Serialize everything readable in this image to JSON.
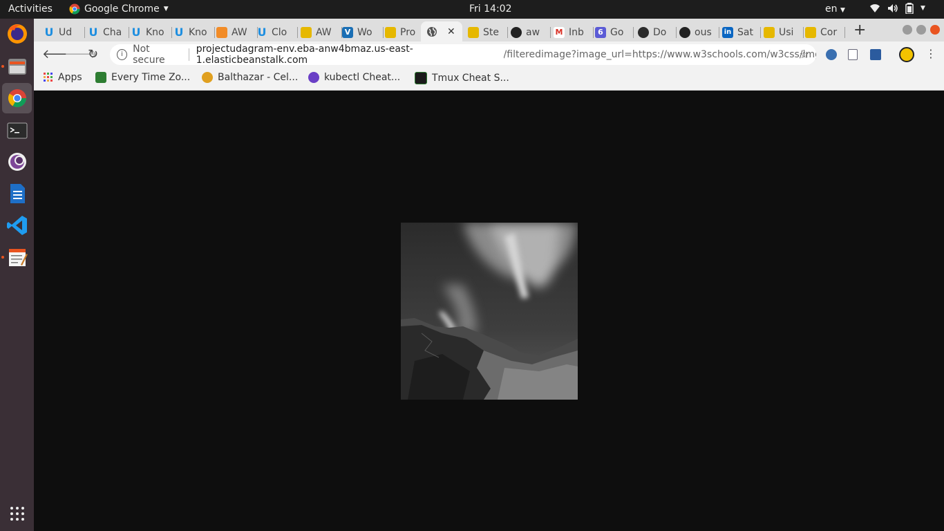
{
  "topbar": {
    "activities": "Activities",
    "app_name": "Google Chrome",
    "clock": "Fri 14:02",
    "language": "en"
  },
  "dock": {
    "items": [
      "firefox",
      "files",
      "chrome",
      "terminal",
      "tor-browser",
      "libreoffice-writer",
      "vscode",
      "text-editor"
    ],
    "show_apps_icon": "grid-icon"
  },
  "tabs": [
    {
      "label": "Ud",
      "icon": "udacity-icon",
      "color": "#1f8fe0"
    },
    {
      "label": "Cha",
      "icon": "udacity-icon",
      "color": "#1f8fe0"
    },
    {
      "label": "Kno",
      "icon": "udacity-icon",
      "color": "#1f8fe0"
    },
    {
      "label": "Kno",
      "icon": "udacity-icon",
      "color": "#1f8fe0"
    },
    {
      "label": "AW",
      "icon": "aws-icon",
      "color": "#f28c28"
    },
    {
      "label": "Clo",
      "icon": "udacity-icon",
      "color": "#1f8fe0"
    },
    {
      "label": "AW",
      "icon": "aws-cube-icon",
      "color": "#e6b800"
    },
    {
      "label": "Wo",
      "icon": "vimeo-icon",
      "color": "#1a6fb5"
    },
    {
      "label": "Pro",
      "icon": "aws-cube-icon",
      "color": "#e6b800"
    },
    {
      "label": "",
      "icon": "globe-icon",
      "color": "#555555",
      "active": true
    },
    {
      "label": "Ste",
      "icon": "aws-cube-icon",
      "color": "#e6b800"
    },
    {
      "label": "aw",
      "icon": "github-icon",
      "color": "#222222"
    },
    {
      "label": "Inb",
      "icon": "gmail-icon",
      "color": "#d93025"
    },
    {
      "label": "Go",
      "icon": "calendar-icon",
      "color": "#5b5bd6"
    },
    {
      "label": "Do",
      "icon": "docker-icon",
      "color": "#2c2c2c"
    },
    {
      "label": "ous",
      "icon": "github-icon",
      "color": "#222222"
    },
    {
      "label": "Sat",
      "icon": "linkedin-icon",
      "color": "#0a66c2"
    },
    {
      "label": "Usi",
      "icon": "aws-cube-icon",
      "color": "#e6b800"
    },
    {
      "label": "Cor",
      "icon": "aws-cube-icon",
      "color": "#e6b800"
    }
  ],
  "toolbar": {
    "not_secure": "Not secure",
    "url_host": "projectudagram-env.eba-anw4bmaz.us-east-1.elasticbeanstalk.com",
    "url_path": "/filteredimage?image_url=https://www.w3schools.com/w3css/img_l..."
  },
  "bookmarks": [
    {
      "label": "Apps",
      "icon": "apps-grid-icon"
    },
    {
      "label": "Every Time Zo...",
      "icon": "clock-icon"
    },
    {
      "label": "Balthazar - Cel...",
      "icon": "celery-icon"
    },
    {
      "label": "kubectl Cheat...",
      "icon": "kubernetes-icon"
    },
    {
      "label": "Tmux Cheat S...",
      "icon": "tmux-icon"
    }
  ],
  "content": {
    "image": "grayscale aurora over snowy mountains",
    "image_icon": "aurora-image"
  }
}
